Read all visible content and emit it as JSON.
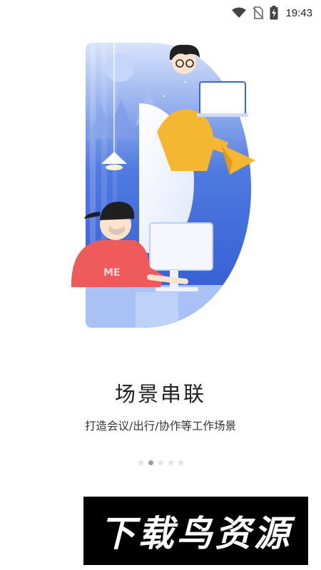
{
  "status_bar": {
    "time": "19:43",
    "icons": [
      "wifi-icon",
      "no-sim-icon",
      "battery-charging-icon"
    ]
  },
  "onboarding": {
    "title": "场景串联",
    "subtitle": "打造会议/出行/协作等工作场景",
    "page_indicator": {
      "total": 5,
      "current": 2
    }
  },
  "watermark": {
    "text": "下载鸟资源"
  },
  "colors": {
    "primary_blue": "#3a63d8",
    "light_blue": "#cfdcf8",
    "accent_yellow": "#f5b731",
    "shirt_red": "#ef5a5a"
  }
}
